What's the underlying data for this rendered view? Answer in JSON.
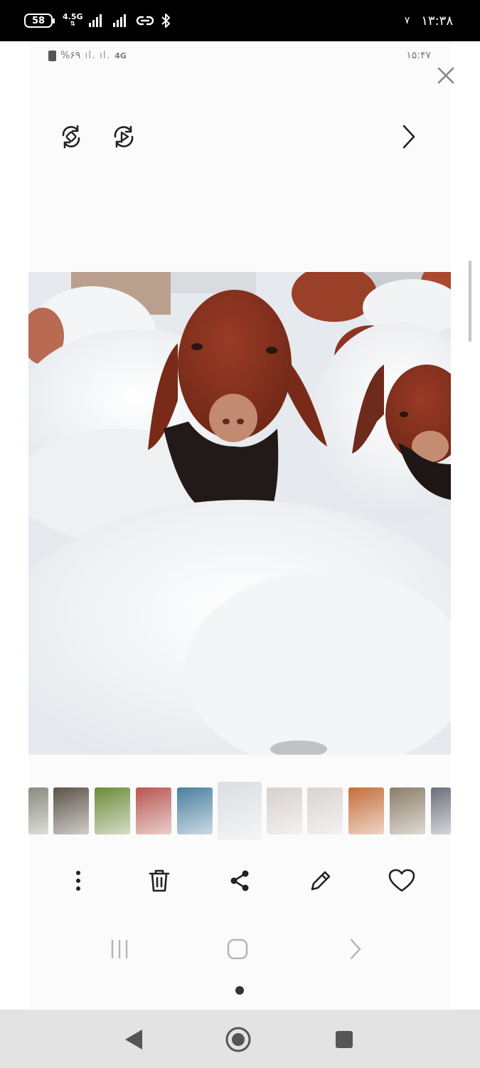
{
  "status_bar": {
    "battery": "58",
    "network_type": "4.5G",
    "network_sub": "4G",
    "time": "۱۳:۳۸",
    "extra_indicator": "۷"
  },
  "inner_status_bar": {
    "battery_percent": "%۶۹",
    "network": "4G",
    "time": "۱۵:۴۷"
  },
  "gallery": {
    "toolbar": {
      "remaster_icon": "auto-rotate-icon",
      "motion_icon": "motion-photo-icon",
      "next_icon": "chevron-right-icon"
    },
    "photo_subject": "sheep",
    "thumbnails": [
      {
        "name": "thumb-1",
        "color": "#8a8a80"
      },
      {
        "name": "thumb-2",
        "color": "#5a5348"
      },
      {
        "name": "thumb-3",
        "color": "#6b8b3a"
      },
      {
        "name": "thumb-4",
        "color": "#b7564f"
      },
      {
        "name": "thumb-5",
        "color": "#4a7f9e"
      },
      {
        "name": "thumb-6-active",
        "color": "#dcdde0"
      },
      {
        "name": "thumb-7",
        "color": "#d7d0cc"
      },
      {
        "name": "thumb-8",
        "color": "#d8d3cf"
      },
      {
        "name": "thumb-9",
        "color": "#c46e3a"
      },
      {
        "name": "thumb-10",
        "color": "#8b7e69"
      },
      {
        "name": "thumb-11",
        "color": "#6a6f7a"
      }
    ],
    "actions": [
      "more-icon",
      "trash-icon",
      "share-icon",
      "edit-icon",
      "heart-icon"
    ]
  },
  "colors": {
    "statusbar_bg": "#000000",
    "panel_bg": "#fbfbfb",
    "icon": "#222222",
    "sysnav_bg": "#e3e3e3"
  }
}
